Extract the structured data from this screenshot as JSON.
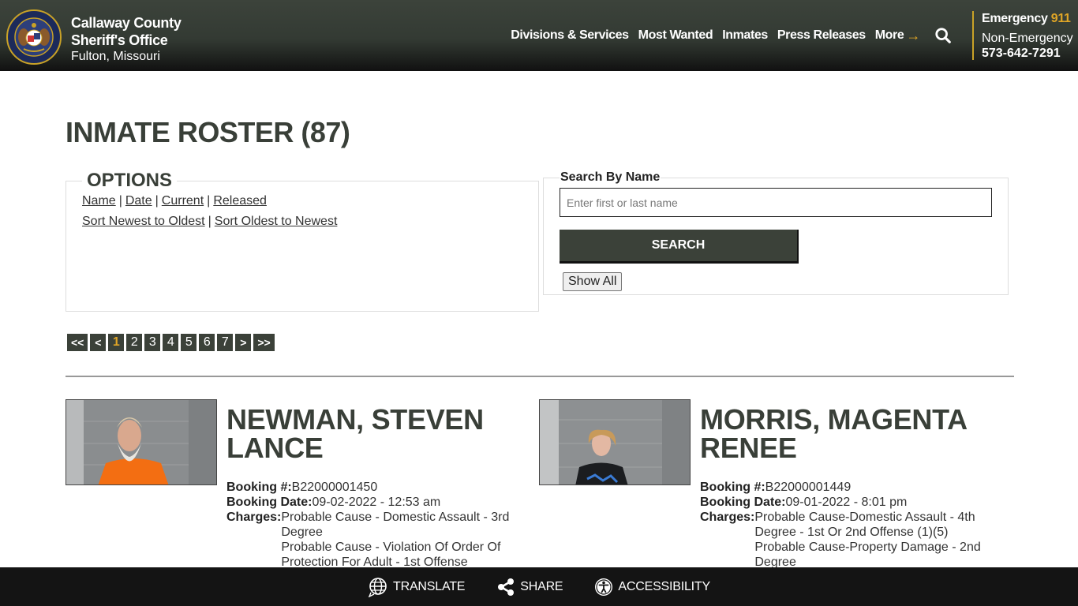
{
  "header": {
    "org_line1": "Callaway County",
    "org_line2": "Sheriff's Office",
    "location": "Fulton, Missouri",
    "logo": "county-sheriff-seal",
    "nav": [
      {
        "label": "Divisions & Services"
      },
      {
        "label": "Most Wanted"
      },
      {
        "label": "Inmates"
      },
      {
        "label": "Press Releases"
      },
      {
        "label": "More"
      }
    ],
    "more_arrow": "→",
    "search_icon": "search-icon",
    "emergency_label": "Emergency",
    "emergency_number": "911",
    "non_emergency_label": "Non-Emergency",
    "non_emergency_number": "573-642-7291"
  },
  "main": {
    "title": "INMATE ROSTER (87)",
    "options": {
      "legend": "OPTIONS",
      "filter_links": [
        "Name",
        "Date",
        "Current",
        "Released"
      ],
      "sort_links": [
        "Sort Newest to Oldest",
        "Sort Oldest to Newest"
      ],
      "separator": "|"
    },
    "search": {
      "legend": "Search By Name",
      "placeholder": "Enter first or last name",
      "value": "",
      "search_label": "SEARCH",
      "show_all_label": "Show All"
    },
    "pagination": {
      "first": "<<",
      "prev": "<",
      "pages": [
        "1",
        "2",
        "3",
        "4",
        "5",
        "6",
        "7"
      ],
      "current": "1",
      "next": ">",
      "last": ">>"
    },
    "inmates": [
      {
        "name_line1": "NEWMAN, STEVEN",
        "name_line2": "LANCE",
        "booking_no_label": "Booking #:",
        "booking_no": "B22000001450",
        "booking_date_label": "Booking Date:",
        "booking_date": "09-02-2022 - 12:53 am",
        "charges_label": "Charges:",
        "charges": [
          "Probable Cause - Domestic Assault - 3rd",
          "Degree",
          "Probable Cause - Violation Of Order Of",
          "Protection For Adult - 1st Offense"
        ]
      },
      {
        "name_line1": "MORRIS, MAGENTA",
        "name_line2": "RENEE",
        "booking_no_label": "Booking #:",
        "booking_no": "B22000001449",
        "booking_date_label": "Booking Date:",
        "booking_date": "09-01-2022 - 8:01 pm",
        "charges_label": "Charges:",
        "charges": [
          "Probable Cause-Domestic Assault - 4th",
          "Degree - 1st Or 2nd Offense (1)(5)",
          "Probable Cause-Property Damage - 2nd",
          "Degree"
        ]
      }
    ]
  },
  "footer": {
    "translate": "TRANSLATE",
    "share": "SHARE",
    "accessibility": "ACCESSIBILITY"
  },
  "colors": {
    "header_bg": "#3c433b",
    "accent_gold": "#e0a526",
    "button_dark": "#3b4139",
    "footer_bg": "#141414"
  }
}
